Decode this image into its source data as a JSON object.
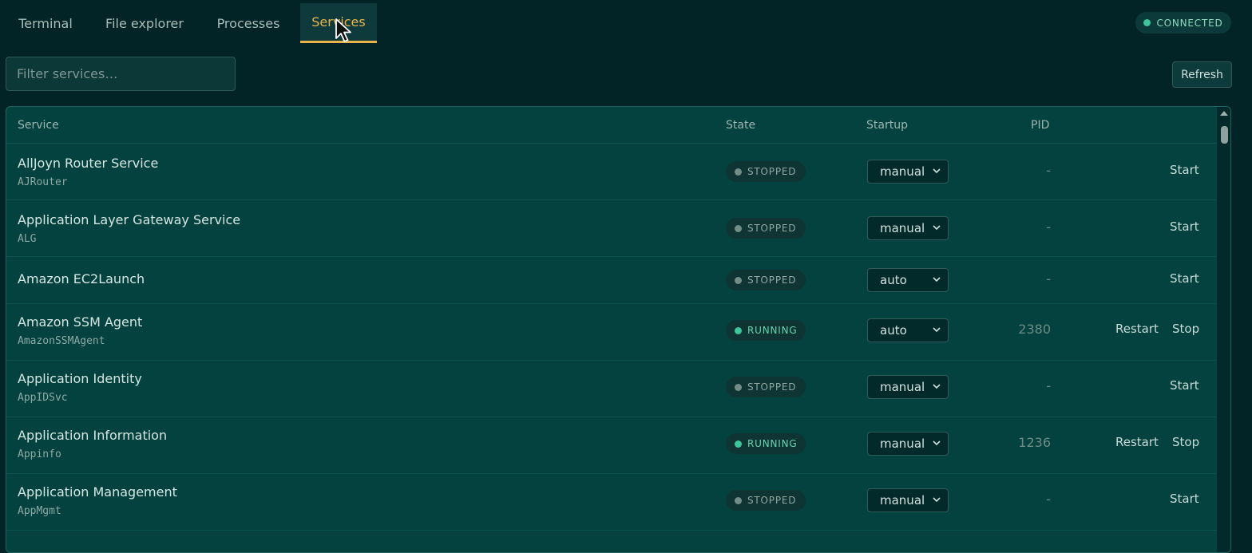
{
  "tabs": [
    {
      "label": "Terminal"
    },
    {
      "label": "File explorer"
    },
    {
      "label": "Processes"
    },
    {
      "label": "Services"
    }
  ],
  "active_tab": "Services",
  "connection": {
    "label": "CONNECTED"
  },
  "filter": {
    "placeholder": "Filter services…",
    "value": ""
  },
  "toolbar": {
    "refresh_label": "Refresh"
  },
  "table": {
    "columns": {
      "service": "Service",
      "state": "State",
      "startup": "Startup",
      "pid": "PID"
    },
    "rows": [
      {
        "name": "AllJoyn Router Service",
        "id": "AJRouter",
        "state": "STOPPED",
        "startup": "manual",
        "pid": "-",
        "action1": "",
        "action2": "Start"
      },
      {
        "name": "Application Layer Gateway Service",
        "id": "ALG",
        "state": "STOPPED",
        "startup": "manual",
        "pid": "-",
        "action1": "",
        "action2": "Start"
      },
      {
        "name": "Amazon EC2Launch",
        "id": "",
        "state": "STOPPED",
        "startup": "auto",
        "pid": "-",
        "action1": "",
        "action2": "Start"
      },
      {
        "name": "Amazon SSM Agent",
        "id": "AmazonSSMAgent",
        "state": "RUNNING",
        "startup": "auto",
        "pid": "2380",
        "action1": "Restart",
        "action2": "Stop"
      },
      {
        "name": "Application Identity",
        "id": "AppIDSvc",
        "state": "STOPPED",
        "startup": "manual",
        "pid": "-",
        "action1": "",
        "action2": "Start"
      },
      {
        "name": "Application Information",
        "id": "Appinfo",
        "state": "RUNNING",
        "startup": "manual",
        "pid": "1236",
        "action1": "Restart",
        "action2": "Stop"
      },
      {
        "name": "Application Management",
        "id": "AppMgmt",
        "state": "STOPPED",
        "startup": "manual",
        "pid": "-",
        "action1": "",
        "action2": "Start"
      }
    ]
  },
  "colors": {
    "background": "#032427",
    "panel": "#03423f",
    "accent": "#e8b34a",
    "running": "#3ec59a",
    "stopped": "#748c88"
  }
}
